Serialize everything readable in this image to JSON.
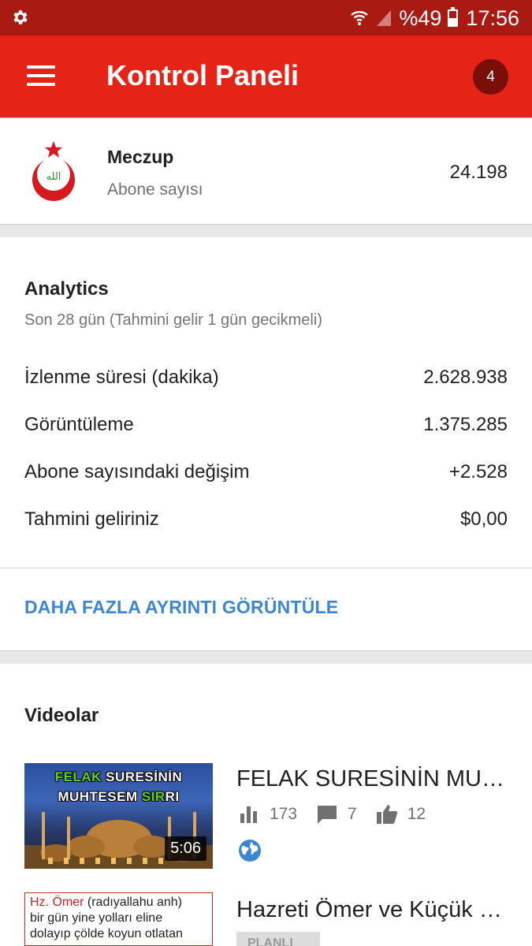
{
  "status_bar": {
    "battery": "%49",
    "time": "17:56"
  },
  "app_bar": {
    "title": "Kontrol Paneli",
    "notifications": "4"
  },
  "channel": {
    "name": "Meczup",
    "subscriber_label": "Abone sayısı",
    "subscriber_count": "24.198"
  },
  "analytics": {
    "title": "Analytics",
    "subtitle": "Son 28 gün (Tahmini gelir 1 gün gecikmeli)",
    "rows": [
      {
        "label": "İzlenme süresi (dakika)",
        "value": "2.628.938"
      },
      {
        "label": "Görüntüleme",
        "value": "1.375.285"
      },
      {
        "label": "Abone sayısındaki değişim",
        "value": "+2.528"
      },
      {
        "label": "Tahmini geliriniz",
        "value": "$0,00"
      }
    ],
    "more_link": "DAHA FAZLA AYRINTI GÖRÜNTÜLE"
  },
  "videos": {
    "title": "Videolar",
    "items": [
      {
        "title": "FELAK SURESİNİN MUHTESEM SIRRI",
        "thumb_line1_a": "FELAK",
        "thumb_line1_b": " SURESİNİN",
        "thumb_line2_a": "MUHTESEM ",
        "thumb_line2_b": "SIR",
        "thumb_line2_c": "RI",
        "duration": "5:06",
        "views": "173",
        "comments": "7",
        "likes": "12",
        "visibility_icon": "globe-icon"
      },
      {
        "title": "Hazreti Ömer ve Küçük Çoban",
        "thumb_name": "Hz. Ömer",
        "thumb_text1": " (radıyallahu anh)",
        "thumb_text2": "bir gün yine yolları eline",
        "thumb_text3": "dolayıp çölde koyun otlatan",
        "tag": "PLANLI"
      }
    ]
  },
  "colors": {
    "status_bar": "#a91a12",
    "app_bar": "#e52417",
    "badge": "#7a0f0a",
    "link": "#3d86d6"
  }
}
